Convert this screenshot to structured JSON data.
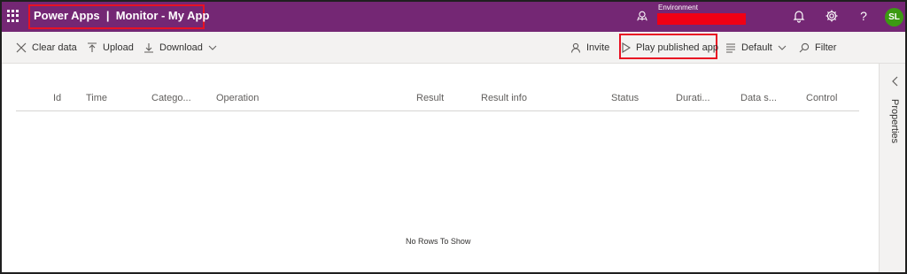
{
  "header": {
    "app_title": "Power Apps  |  Monitor - My App",
    "environment_label": "Environment",
    "environment_value": "",
    "avatar_initials": "SL",
    "help_glyph": "?",
    "background_color": "#742774",
    "icons": [
      "waffle-icon",
      "environment-icon",
      "bell-icon",
      "gear-icon",
      "help-icon"
    ]
  },
  "toolbar": {
    "clear_data": "Clear data",
    "upload": "Upload",
    "download": "Download",
    "invite": "Invite",
    "play_published_app": "Play published app",
    "view": "Default",
    "filter": "Filter"
  },
  "grid": {
    "columns": [
      "Id",
      "Time",
      "Catego...",
      "Operation",
      "Result",
      "Result info",
      "Status",
      "Durati...",
      "Data s...",
      "Control"
    ],
    "empty_message": "No Rows To Show"
  },
  "properties_panel": {
    "label": "Properties"
  },
  "colors": {
    "highlight": "#e81123",
    "avatar": "#3c9a13",
    "redacted": "#f00014"
  }
}
